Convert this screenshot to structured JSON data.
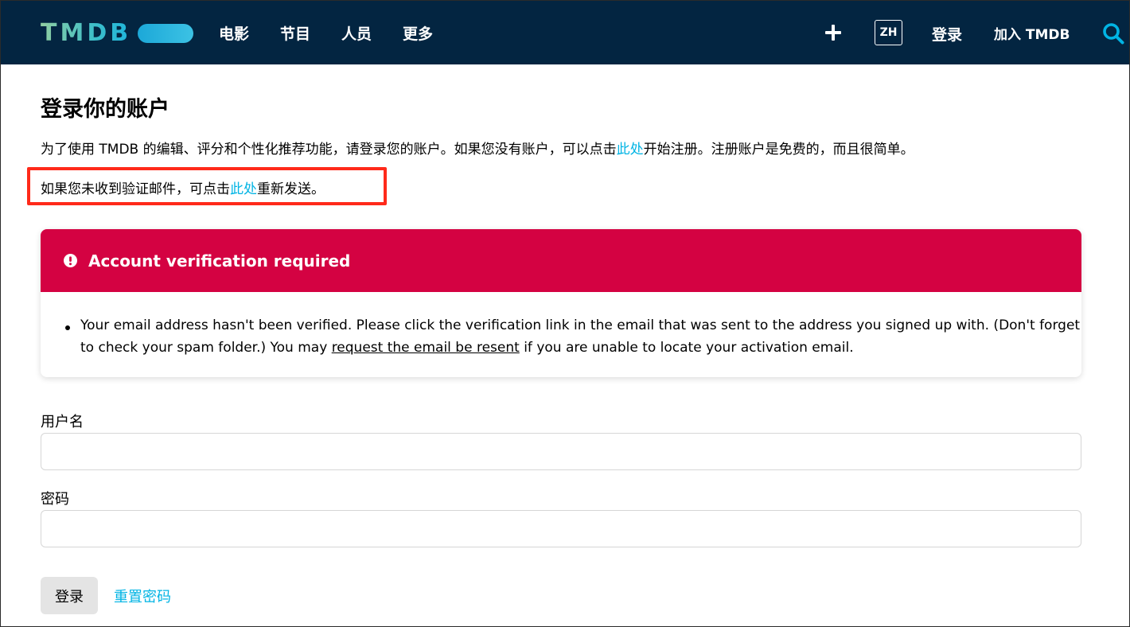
{
  "header": {
    "logo_text": "TMDB",
    "nav": [
      "电影",
      "节目",
      "人员",
      "更多"
    ],
    "lang": "ZH",
    "login": "登录",
    "join": "加入 TMDB"
  },
  "main": {
    "title": "登录你的账户",
    "intro_before": "为了使用 TMDB 的编辑、评分和个性化推荐功能，请登录您的账户。如果您没有账户，可以点击",
    "intro_link": "此处",
    "intro_after": "开始注册。注册账户是免费的，而且很简单。",
    "resend_before": "如果您未收到验证邮件，可点击",
    "resend_link": "此处",
    "resend_after": "重新发送。"
  },
  "alert": {
    "title": "Account verification required",
    "line1": "Your email address hasn't been verified. Please click the verification link in the email that was sent to the address you signed up with. (Don't forget",
    "line2_before": "to check your spam folder.) You may ",
    "line2_link": "request the email be resent",
    "line2_after": " if you are unable to locate your activation email."
  },
  "form": {
    "username_label": "用户名",
    "username_value": "",
    "password_label": "密码",
    "password_value": "",
    "login_button": "登录",
    "reset_link": "重置密码"
  },
  "colors": {
    "header_bg": "#032541",
    "alert_red": "#d40242",
    "link_blue": "#01b4e4",
    "highlight_red": "#ff2a1a"
  }
}
